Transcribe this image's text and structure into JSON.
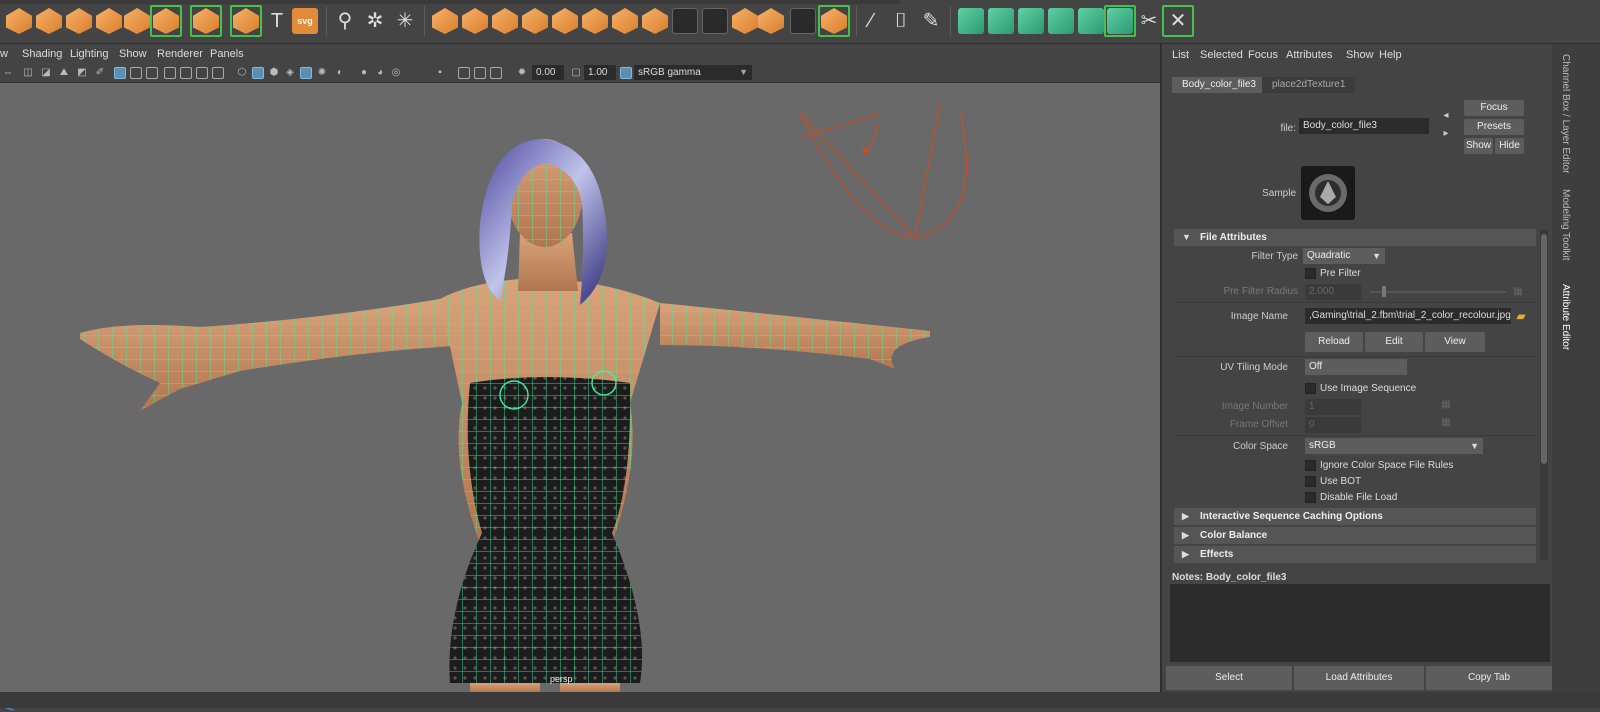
{
  "viewport": {
    "menus": [
      "w",
      "Shading",
      "Lighting",
      "Show",
      "Renderer",
      "Panels"
    ],
    "fields": {
      "exposure": "0.00",
      "gamma": "1.00"
    },
    "color_space": "sRGB gamma",
    "camera_label": "persp"
  },
  "attribute_editor": {
    "menus": [
      "List",
      "Selected",
      "Focus",
      "Attributes",
      "Show",
      "Help"
    ],
    "tabs": [
      "Body_color_file3",
      "place2dTexture1"
    ],
    "buttons": {
      "focus": "Focus",
      "presets": "Presets",
      "show": "Show",
      "hide": "Hide"
    },
    "node_label": "file:",
    "node_name": "Body_color_file3",
    "sample_label": "Sample",
    "file_attributes": {
      "section": "File Attributes",
      "filter_type_label": "Filter Type",
      "filter_type": "Quadratic",
      "pre_filter": "Pre Filter",
      "pre_filter_radius_label": "Pre Filter Radius",
      "pre_filter_radius": "2.000",
      "image_name_label": "Image Name",
      "image_name": ",Gaming\\trial_2.fbm\\trial_2_color_recolour.jpg",
      "reload": "Reload",
      "edit": "Edit",
      "view": "View",
      "uv_tiling_label": "UV Tiling Mode",
      "uv_tiling": "Off",
      "use_image_sequence": "Use Image Sequence",
      "image_number_label": "Image Number",
      "image_number": "1",
      "frame_offset_label": "Frame Offset",
      "frame_offset": "0",
      "color_space_label": "Color Space",
      "color_space": "sRGB",
      "ignore_cs_rules": "Ignore Color Space File Rules",
      "use_bot": "Use BOT",
      "disable_file_load": "Disable File Load"
    },
    "collapsed_sections": [
      "Interactive Sequence Caching Options",
      "Color Balance",
      "Effects"
    ],
    "notes_label": "Notes:  Body_color_file3",
    "footer": [
      "Select",
      "Load Attributes",
      "Copy Tab"
    ]
  },
  "side_tabs": [
    "Channel Box / Layer Editor",
    "Modeling Toolkit",
    "Attribute Editor"
  ],
  "colors": {
    "accent_green": "#46c24a",
    "wire_green": "#3ef09a",
    "shelf_orange": "#e08a3a"
  }
}
